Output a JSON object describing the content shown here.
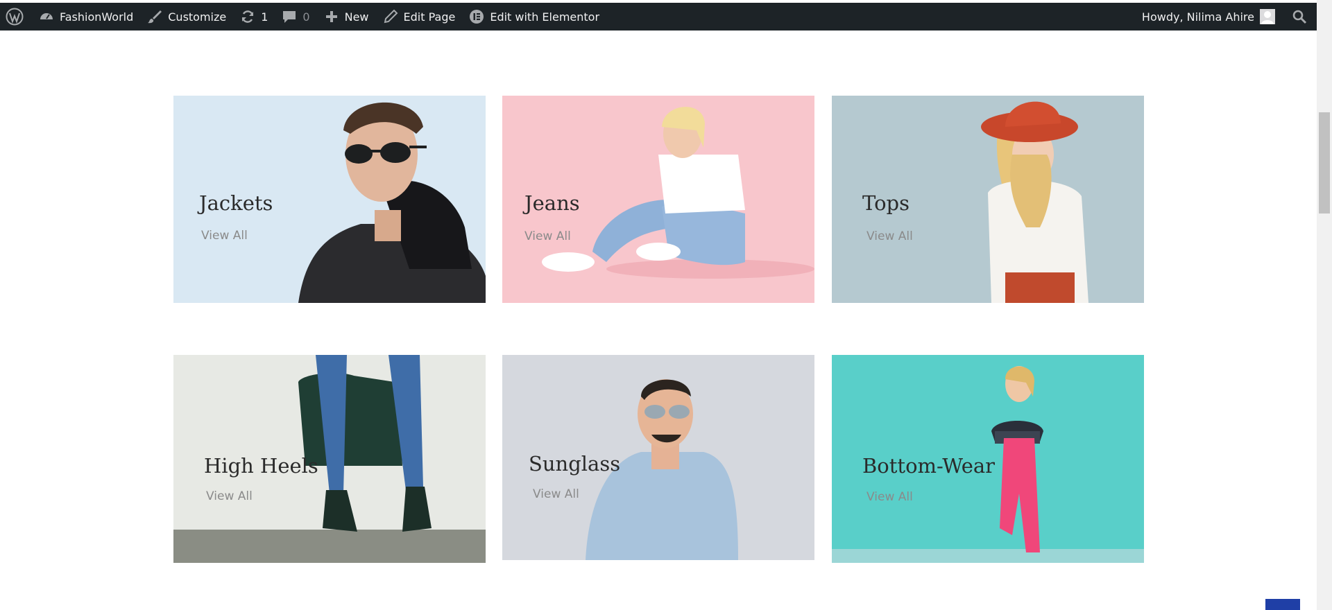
{
  "admin_bar": {
    "site_name": "FashionWorld",
    "customize": "Customize",
    "updates_count": "1",
    "comments_count": "0",
    "new_label": "New",
    "edit_page": "Edit Page",
    "edit_elementor": "Edit with Elementor",
    "greeting": "Howdy, Nilima Ahire"
  },
  "categories": [
    {
      "title": "Jackets",
      "link": "View All",
      "bg": "#d9e8f3"
    },
    {
      "title": "Jeans",
      "link": "View All",
      "bg": "#f8c6cc"
    },
    {
      "title": "Tops",
      "link": "View All",
      "bg": "#b5c9d0"
    },
    {
      "title": "High Heels",
      "link": "View All",
      "bg": "#e7e9e4"
    },
    {
      "title": "Sunglass",
      "link": "View All",
      "bg": "#d5d8de"
    },
    {
      "title": "Bottom-Wear",
      "link": "View All",
      "bg": "#59cfc9"
    }
  ]
}
